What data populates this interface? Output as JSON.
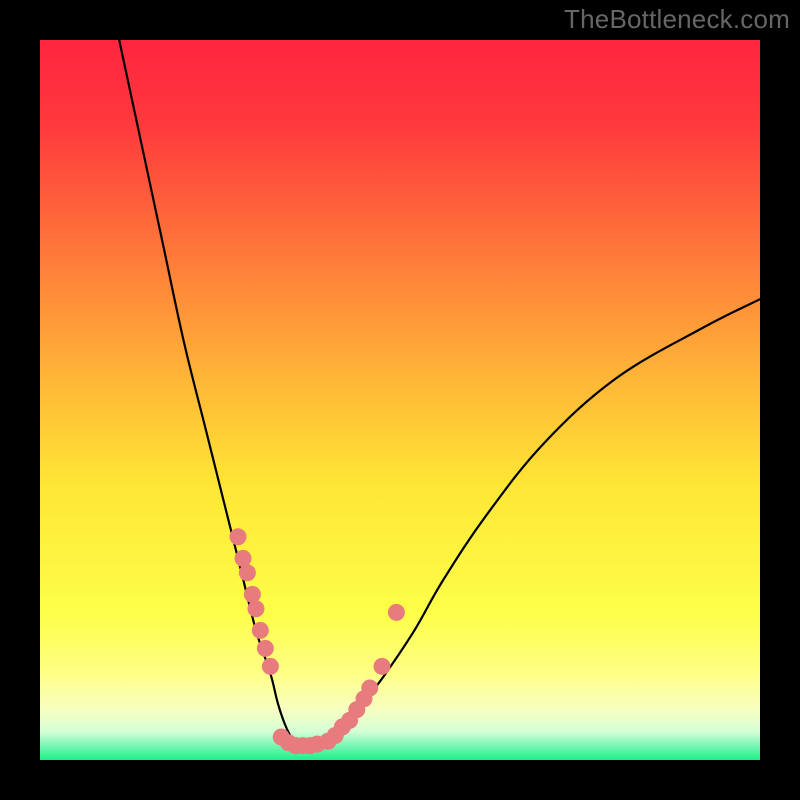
{
  "watermark": "TheBottleneck.com",
  "colors": {
    "top": "#ff263f",
    "mid_upper": "#ff8b36",
    "mid": "#ffe735",
    "lower_yellow": "#ffff6e",
    "pale": "#f8ffcb",
    "green": "#1cf08a",
    "dot": "#e77b7d",
    "curve": "#000000",
    "frame": "#000000"
  },
  "chart_data": {
    "type": "line",
    "title": "",
    "xlabel": "",
    "ylabel": "",
    "xlim": [
      0,
      100
    ],
    "ylim": [
      0,
      100
    ],
    "series": [
      {
        "name": "bottleneck-curve",
        "x": [
          11,
          14,
          17,
          20,
          23,
          26,
          28,
          30,
          32,
          33,
          34,
          35,
          36,
          37,
          38,
          39,
          41,
          43,
          45,
          48,
          52,
          56,
          62,
          70,
          80,
          92,
          100
        ],
        "values": [
          100,
          86,
          72,
          58,
          46,
          34,
          26,
          18,
          12,
          8,
          5,
          3,
          2,
          1.5,
          1.5,
          2,
          3,
          5,
          8,
          12,
          18,
          25,
          34,
          44,
          53,
          60,
          64
        ]
      }
    ],
    "highlight_points": {
      "name": "tested-configs",
      "x": [
        27.5,
        28.2,
        28.8,
        29.5,
        30.0,
        30.6,
        31.3,
        32.0,
        33.5,
        34.5,
        35.5,
        36.5,
        37.5,
        38.5,
        40.0,
        41.0,
        42.0,
        43.0,
        44.0,
        45.0,
        45.8,
        47.5,
        49.5
      ],
      "values": [
        31,
        28,
        26,
        23,
        21,
        18,
        15.5,
        13,
        3.2,
        2.4,
        2.0,
        2.0,
        2.0,
        2.2,
        2.6,
        3.4,
        4.6,
        5.5,
        7.0,
        8.5,
        10,
        13,
        20.5
      ],
      "note": "Values estimated from plot; y is bottleneck % (0 = green bottom, 100 = top)."
    }
  }
}
